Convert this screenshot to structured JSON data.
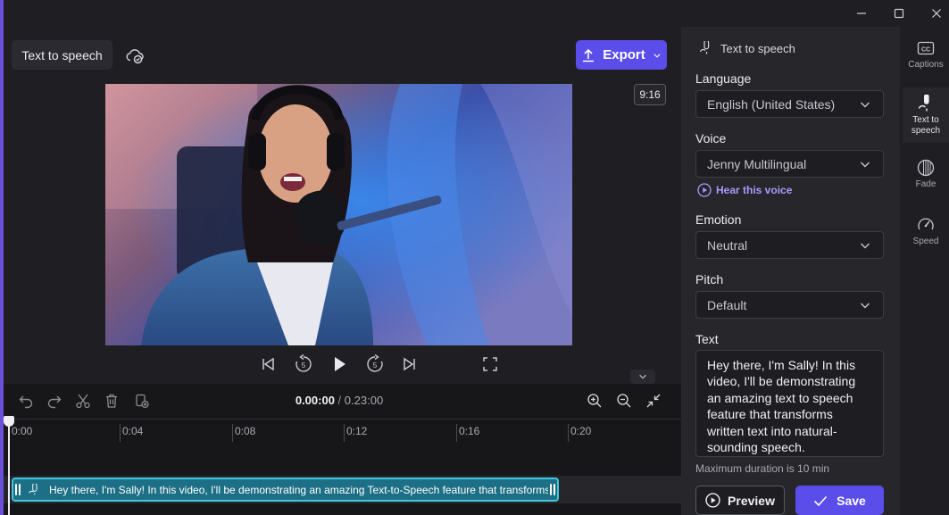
{
  "project": {
    "tab_label": "Text to speech",
    "export_label": "Export",
    "aspect_ratio": "9:16"
  },
  "timeline": {
    "current_time": "0.00:00",
    "separator": "/",
    "total_time": "0.23:00",
    "ticks": [
      "0:00",
      "0:04",
      "0:08",
      "0:12",
      "0:16",
      "0:20"
    ],
    "clip_text": "Hey there, I'm Sally! In this video, I'll be demonstrating an amazing Text-to-Speech feature that transforms wr"
  },
  "panel": {
    "title": "Text to speech",
    "language": {
      "label": "Language",
      "value": "English (United States)"
    },
    "voice": {
      "label": "Voice",
      "value": "Jenny Multilingual",
      "hear_link": "Hear this voice"
    },
    "emotion": {
      "label": "Emotion",
      "value": "Neutral"
    },
    "pitch": {
      "label": "Pitch",
      "value": "Default"
    },
    "text": {
      "label": "Text",
      "value": "Hey there, I'm Sally! In this video, I'll be demonstrating an amazing text to speech feature that transforms written text into natural-sounding speech.",
      "hint": "Maximum duration is 10 min"
    },
    "preview_label": "Preview",
    "save_label": "Save"
  },
  "rail": {
    "captions": "Captions",
    "tts": "Text to speech",
    "fade": "Fade",
    "speed": "Speed"
  },
  "colors": {
    "accent": "#5b4dea",
    "clip": "#1d6f86",
    "clip_border": "#3ec8de",
    "link": "#a99bff"
  }
}
